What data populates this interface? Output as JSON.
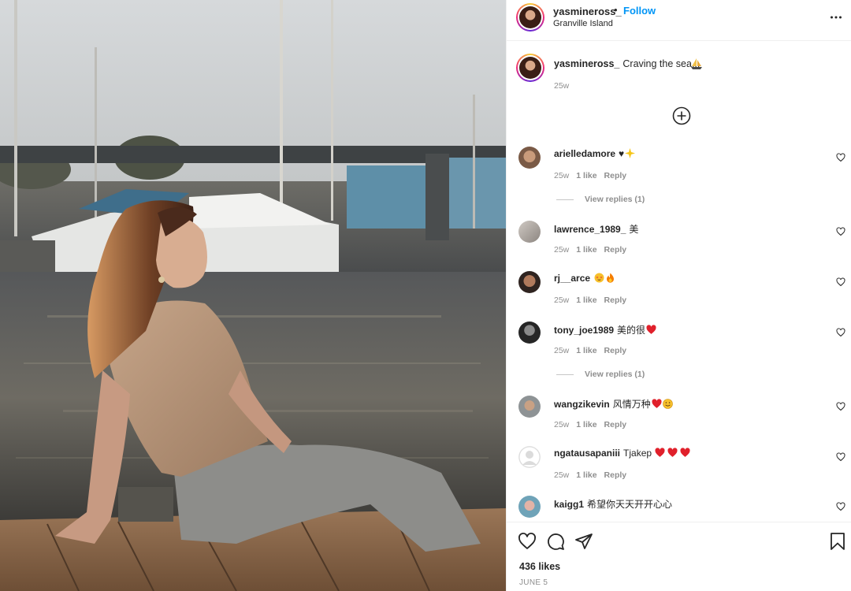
{
  "post": {
    "username": "yasmineross_",
    "separator": "•",
    "follow_label": "Follow",
    "location": "Granville Island",
    "caption_text": "Craving the sea...",
    "caption_time": "25w",
    "likes": "436 likes",
    "date": "JUNE 5"
  },
  "comments": [
    {
      "user": "arielledamore",
      "text": "♥",
      "time": "25w",
      "likes": "1 like",
      "reply": "Reply",
      "view_replies": "View replies (1)"
    },
    {
      "user": "lawrence_1989_",
      "text": "美",
      "time": "25w",
      "likes": "1 like",
      "reply": "Reply"
    },
    {
      "user": "rj__arce",
      "text": "",
      "time": "25w",
      "likes": "1 like",
      "reply": "Reply"
    },
    {
      "user": "tony_joe1989",
      "text": "美的很",
      "time": "25w",
      "likes": "1 like",
      "reply": "Reply",
      "view_replies": "View replies (1)"
    },
    {
      "user": "wangzikevin",
      "text": "风情万种",
      "time": "25w",
      "likes": "1 like",
      "reply": "Reply"
    },
    {
      "user": "ngatausapaniii",
      "text": "Tjakep",
      "time": "25w",
      "likes": "1 like",
      "reply": "Reply"
    },
    {
      "user": "kaigg1",
      "text": "希望你天天开开心心"
    }
  ],
  "icons": {
    "more": "more-options-icon",
    "load_more": "plus-circle-icon",
    "like": "heart-icon",
    "comment": "comment-icon",
    "share": "share-icon",
    "save": "bookmark-icon"
  },
  "colors": {
    "accent": "#0095f6",
    "text": "#262626",
    "muted": "#8e8e8e",
    "heart_red": "#ed1c24"
  }
}
